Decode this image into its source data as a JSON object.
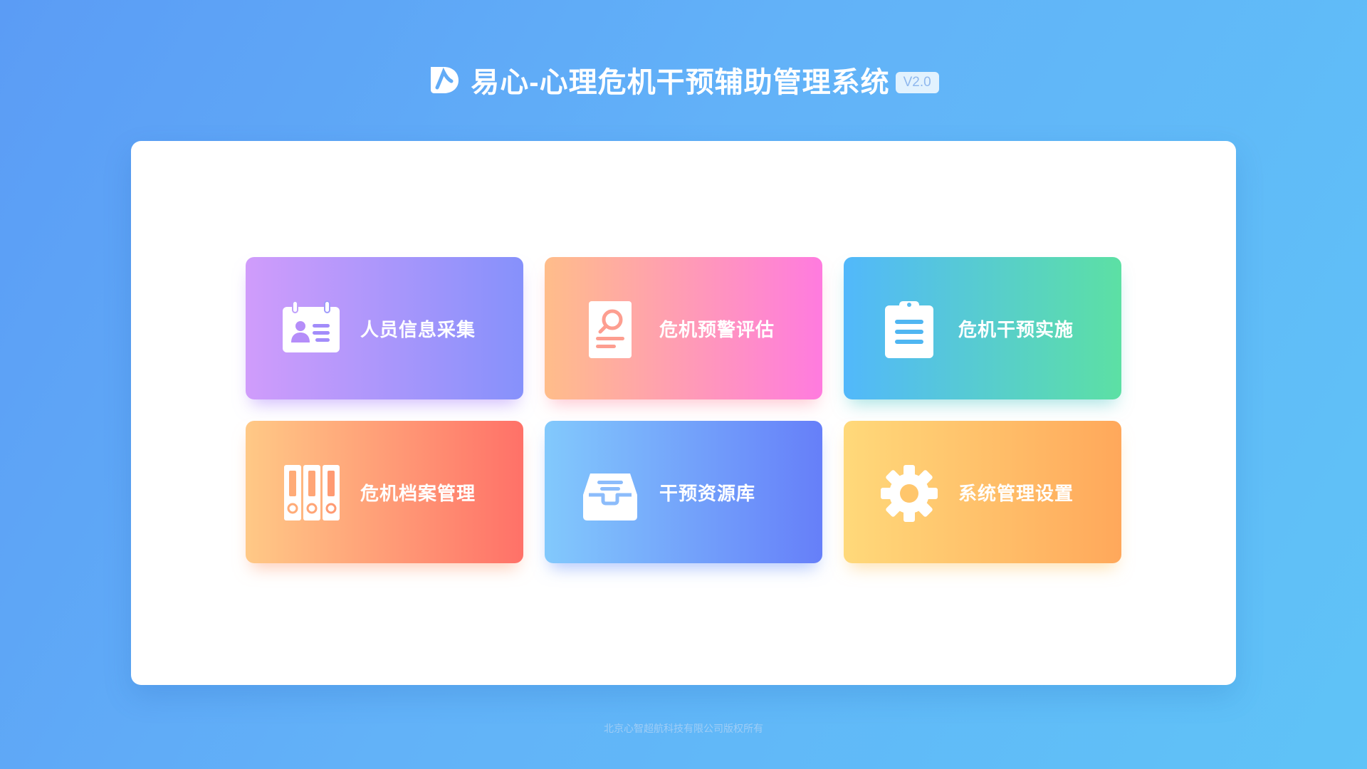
{
  "header": {
    "logo_icon": "heart-d-logo-icon",
    "title": "易心-心理危机干预辅助管理系统",
    "version": "V2.0"
  },
  "modules": [
    {
      "label": "人员信息采集",
      "icon": "id-card-icon",
      "gradient": [
        "#d09cfb",
        "#8691fb"
      ]
    },
    {
      "label": "危机预警评估",
      "icon": "search-document-icon",
      "gradient": [
        "#ffbd8a",
        "#ff7bdf"
      ]
    },
    {
      "label": "危机干预实施",
      "icon": "clipboard-icon",
      "gradient": [
        "#52b8fb",
        "#5ce0a4"
      ]
    },
    {
      "label": "危机档案管理",
      "icon": "binders-icon",
      "gradient": [
        "#ffc986",
        "#ff7168"
      ]
    },
    {
      "label": "干预资源库",
      "icon": "inbox-tray-icon",
      "gradient": [
        "#82c9fc",
        "#667ff9"
      ]
    },
    {
      "label": "系统管理设置",
      "icon": "gear-icon",
      "gradient": [
        "#ffd97a",
        "#ffa85b"
      ]
    }
  ],
  "footer": {
    "copyright": "北京心智超航科技有限公司版权所有"
  }
}
